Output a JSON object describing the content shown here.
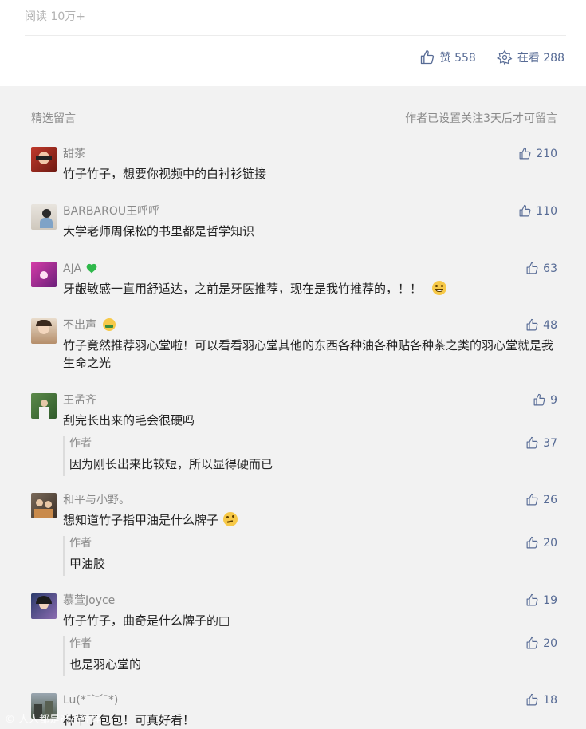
{
  "header": {
    "read_label": "阅读 10万+",
    "like_label": "赞 558",
    "watching_label": "在看 288"
  },
  "comments_section": {
    "title": "精选留言",
    "notice": "作者已设置关注3天后才可留言"
  },
  "comments": [
    {
      "nick": "甜茶",
      "text": "竹子竹子，想要你视频中的白衬衫链接",
      "likes": "210"
    },
    {
      "nick": "BARBAROU王呼呼",
      "text": "大学老师周保松的书里都是哲学知识",
      "likes": "110"
    },
    {
      "nick": "AJA",
      "text": "牙龈敏感一直用舒适达，之前是牙医推荐，现在是我竹推荐的，！！",
      "likes": "63"
    },
    {
      "nick": "不出声",
      "text": "竹子竟然推荐羽心堂啦！可以看看羽心堂其他的东西各种油各种贴各种茶之类的羽心堂就是我生命之光",
      "likes": "48"
    },
    {
      "nick": "王孟齐",
      "text": "刮完长出来的毛会很硬吗",
      "likes": "9",
      "reply": {
        "nick": "作者",
        "text": "因为刚长出来比较短，所以显得硬而已",
        "likes": "37"
      }
    },
    {
      "nick": "和平与小野。",
      "text": "想知道竹子指甲油是什么牌子",
      "likes": "26",
      "reply": {
        "nick": "作者",
        "text": "甲油胶",
        "likes": "20"
      }
    },
    {
      "nick": "慕萱Joyce",
      "text": "竹子竹子，曲奇是什么牌子的□",
      "likes": "19",
      "reply": {
        "nick": "作者",
        "text": "也是羽心堂的",
        "likes": "20"
      }
    },
    {
      "nick": "Lu(*¯︶¯*)",
      "text": "种草了包包！可真好看！",
      "likes": "18"
    }
  ],
  "watermark": "© 人人都是产品经理",
  "colors": {
    "link": "#576b95",
    "muted": "#8a8a8a",
    "text": "#222222",
    "bg": "#f2f2f2"
  }
}
